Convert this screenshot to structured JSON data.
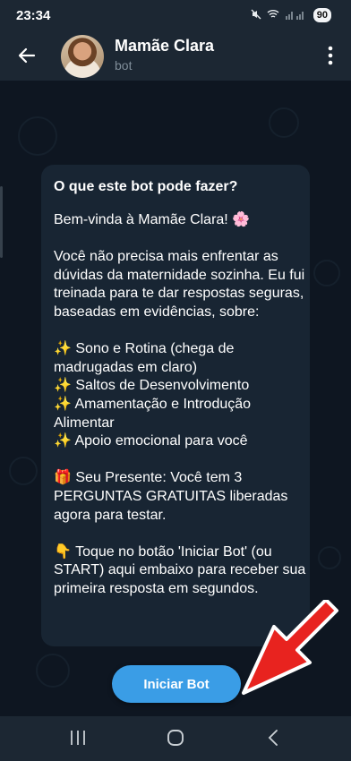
{
  "status_bar": {
    "time": "23:34",
    "battery": "90"
  },
  "header": {
    "title": "Mamãe Clara",
    "subtitle": "bot"
  },
  "intro_card": {
    "title": "O que este bot pode fazer?",
    "text": "Bem-vinda à Mamãe Clara! 🌸\n\nVocê não precisa mais enfrentar as dúvidas da maternidade sozinha. Eu fui treinada para te dar respostas seguras, baseadas em evidências, sobre:\n\n✨ Sono e Rotina (chega de madrugadas em claro)\n✨ Saltos de Desenvolvimento\n✨ Amamentação e Introdução Alimentar\n✨ Apoio emocional para você\n\n🎁 Seu Presente: Você tem 3 PERGUNTAS GRATUITAS liberadas agora para testar.\n\n👇 Toque no botão 'Iniciar Bot' (ou START) aqui embaixo para receber sua primeira resposta em segundos."
  },
  "start_button": {
    "label": "Iniciar Bot"
  },
  "colors": {
    "header_bg": "#1c2733",
    "chat_bg": "#0e1621",
    "card_bg": "#182533",
    "button_bg": "#3a9de6",
    "arrow_red": "#e8231f"
  },
  "icons": {
    "back": "arrow-left-icon",
    "menu": "more-vertical-icon",
    "nav_recent": "recent-apps-icon",
    "nav_home": "home-icon",
    "nav_back": "chevron-left-icon"
  }
}
